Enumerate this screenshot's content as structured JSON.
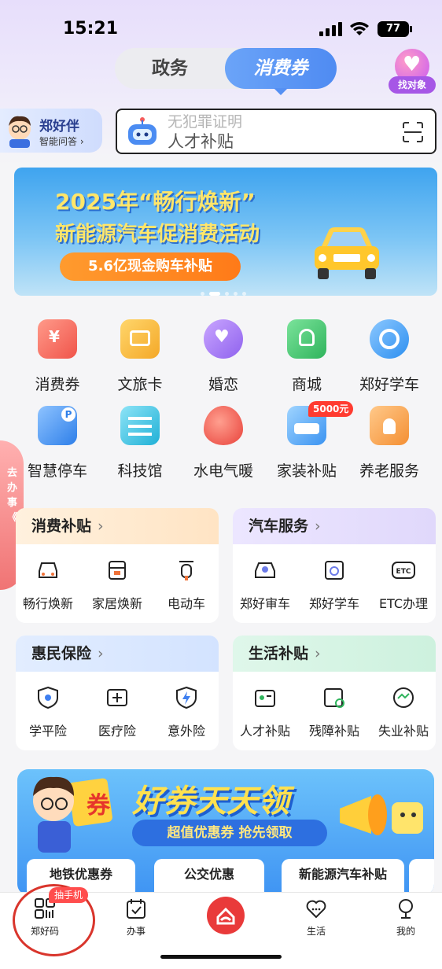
{
  "status_bar": {
    "time": "15:21",
    "battery": "77"
  },
  "segment_tabs": {
    "left": "政务",
    "right": "消费券"
  },
  "find_partner": {
    "label": "找对象"
  },
  "assistant": {
    "name": "郑好伴",
    "sub": "智能问答 ›"
  },
  "search": {
    "hint_faded": "无犯罪证明",
    "placeholder": "人才补贴"
  },
  "banner": {
    "line1": "2025年“畅行焕新”",
    "line2": "新能源汽车促消费活动",
    "pill": "5.6亿现金购车补贴"
  },
  "quick_icons": [
    {
      "label": "消费券",
      "icon": "coupon-icon",
      "color": "#f46a60"
    },
    {
      "label": "文旅卡",
      "icon": "travel-card-icon",
      "color": "#f7b63a"
    },
    {
      "label": "婚恋",
      "icon": "bear-heart-icon",
      "color": "#a77bf0"
    },
    {
      "label": "商城",
      "icon": "shopping-bag-icon",
      "color": "#4cc574"
    },
    {
      "label": "郑好学车",
      "icon": "steering-wheel-icon",
      "color": "#3fa1f0"
    },
    {
      "label": "智慧停车",
      "icon": "parking-icon",
      "color": "#3c8ef0"
    },
    {
      "label": "科技馆",
      "icon": "museum-icon",
      "color": "#33b6d9"
    },
    {
      "label": "水电气暖",
      "icon": "drop-icon",
      "color": "#f2655a"
    },
    {
      "label": "家装补贴",
      "icon": "sofa-icon",
      "color": "#4aa5f5"
    },
    {
      "label": "养老服务",
      "icon": "elder-home-icon",
      "color": "#f6a24b"
    }
  ],
  "badge_5000": "5000元",
  "side_tab": "去办事《",
  "cards": {
    "consume": {
      "title": "消费补贴",
      "items": [
        "畅行焕新",
        "家居焕新",
        "电动车"
      ]
    },
    "car": {
      "title": "汽车服务",
      "items": [
        "郑好审车",
        "郑好学车",
        "ETC办理"
      ]
    },
    "insurance": {
      "title": "惠民保险",
      "items": [
        "学平险",
        "医疗险",
        "意外险"
      ]
    },
    "life": {
      "title": "生活补贴",
      "items": [
        "人才补贴",
        "残障补贴",
        "失业补贴"
      ]
    }
  },
  "etc_icon_text": "ETC",
  "promo": {
    "title": "好券天天领",
    "subtitle": "超值优惠券 抢先领取",
    "coupon_text": "券",
    "chips": [
      "地铁优惠券",
      "公交优惠",
      "新能源汽车补贴"
    ]
  },
  "tabbar": {
    "items": [
      "郑好码",
      "办事",
      "",
      "生活",
      "我的"
    ],
    "badge": "抽手机"
  }
}
